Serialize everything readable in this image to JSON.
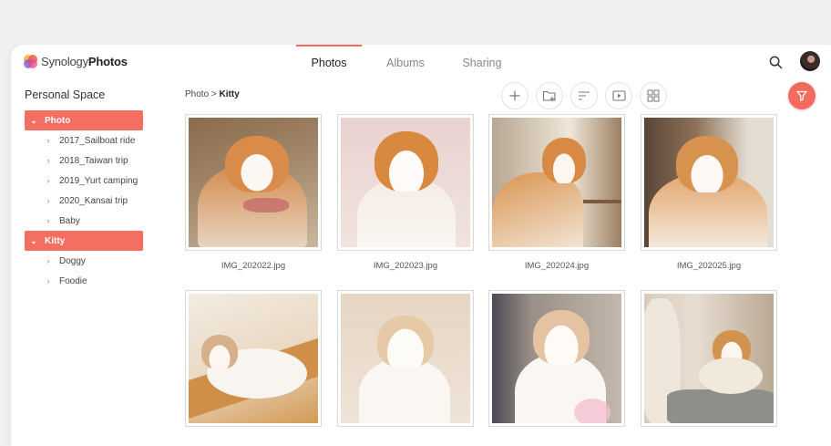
{
  "app": {
    "brand": "Synology",
    "product": "Photos"
  },
  "header": {
    "tabs": [
      {
        "label": "Photos",
        "active": true
      },
      {
        "label": "Albums",
        "active": false
      },
      {
        "label": "Sharing",
        "active": false
      }
    ]
  },
  "sidebar": {
    "title": "Personal Space",
    "items": [
      {
        "label": "Photo",
        "expanded": true,
        "selected": true
      },
      {
        "label": "2017_Sailboat ride"
      },
      {
        "label": "2018_Taiwan trip"
      },
      {
        "label": "2019_Yurt camping"
      },
      {
        "label": "2020_Kansai trip"
      },
      {
        "label": "Baby"
      },
      {
        "label": "Kitty",
        "expanded": true,
        "selected": true
      },
      {
        "label": "Doggy"
      },
      {
        "label": "Foodie"
      }
    ]
  },
  "breadcrumb": {
    "root": "Photo",
    "separator": ">",
    "current": "Kitty"
  },
  "toolbar": {
    "icons": [
      "plus-icon",
      "folder-add-icon",
      "sort-icon",
      "slideshow-icon",
      "grid-view-icon"
    ],
    "filter_icon": "filter-icon"
  },
  "photos": [
    {
      "name": "IMG_202022.jpg"
    },
    {
      "name": "IMG_202023.jpg"
    },
    {
      "name": "IMG_202024.jpg"
    },
    {
      "name": "IMG_202025.jpg"
    },
    {
      "name": ""
    },
    {
      "name": ""
    },
    {
      "name": ""
    },
    {
      "name": ""
    }
  ],
  "colors": {
    "accent": "#f46f62"
  }
}
